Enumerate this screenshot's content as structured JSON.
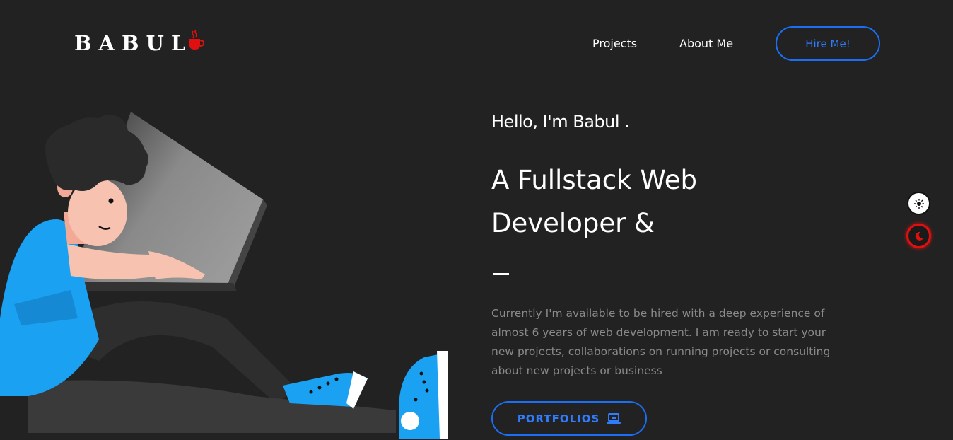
{
  "brand": {
    "name": "BABUL"
  },
  "nav": {
    "projects": "Projects",
    "about": "About Me",
    "hire": "Hire Me!"
  },
  "hero": {
    "greeting": "Hello, I'm Babul .",
    "headline_line1": "A Fullstack Web",
    "headline_line2": "Developer &",
    "description": "Currently I'm available to be hired with a deep experience of almost 6 years of web development. I am ready to start your new projects, collaborations on running projects or consulting about new projects or business",
    "portfolio_button": "PORTFOLIOS"
  },
  "theme_toggle": {
    "light_icon": "sun-icon",
    "dark_icon": "moon-icon"
  },
  "colors": {
    "background": "#222222",
    "accent": "#1b6ff5",
    "logo_cup": "#e01010",
    "shirt": "#1ba1f2"
  }
}
